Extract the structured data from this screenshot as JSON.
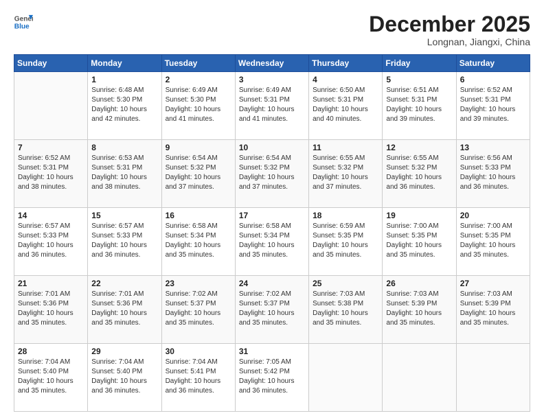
{
  "header": {
    "logo_general": "General",
    "logo_blue": "Blue",
    "month": "December 2025",
    "location": "Longnan, Jiangxi, China"
  },
  "weekdays": [
    "Sunday",
    "Monday",
    "Tuesday",
    "Wednesday",
    "Thursday",
    "Friday",
    "Saturday"
  ],
  "weeks": [
    [
      {
        "day": "",
        "info": ""
      },
      {
        "day": "1",
        "info": "Sunrise: 6:48 AM\nSunset: 5:30 PM\nDaylight: 10 hours\nand 42 minutes."
      },
      {
        "day": "2",
        "info": "Sunrise: 6:49 AM\nSunset: 5:30 PM\nDaylight: 10 hours\nand 41 minutes."
      },
      {
        "day": "3",
        "info": "Sunrise: 6:49 AM\nSunset: 5:31 PM\nDaylight: 10 hours\nand 41 minutes."
      },
      {
        "day": "4",
        "info": "Sunrise: 6:50 AM\nSunset: 5:31 PM\nDaylight: 10 hours\nand 40 minutes."
      },
      {
        "day": "5",
        "info": "Sunrise: 6:51 AM\nSunset: 5:31 PM\nDaylight: 10 hours\nand 39 minutes."
      },
      {
        "day": "6",
        "info": "Sunrise: 6:52 AM\nSunset: 5:31 PM\nDaylight: 10 hours\nand 39 minutes."
      }
    ],
    [
      {
        "day": "7",
        "info": "Sunrise: 6:52 AM\nSunset: 5:31 PM\nDaylight: 10 hours\nand 38 minutes."
      },
      {
        "day": "8",
        "info": "Sunrise: 6:53 AM\nSunset: 5:31 PM\nDaylight: 10 hours\nand 38 minutes."
      },
      {
        "day": "9",
        "info": "Sunrise: 6:54 AM\nSunset: 5:32 PM\nDaylight: 10 hours\nand 37 minutes."
      },
      {
        "day": "10",
        "info": "Sunrise: 6:54 AM\nSunset: 5:32 PM\nDaylight: 10 hours\nand 37 minutes."
      },
      {
        "day": "11",
        "info": "Sunrise: 6:55 AM\nSunset: 5:32 PM\nDaylight: 10 hours\nand 37 minutes."
      },
      {
        "day": "12",
        "info": "Sunrise: 6:55 AM\nSunset: 5:32 PM\nDaylight: 10 hours\nand 36 minutes."
      },
      {
        "day": "13",
        "info": "Sunrise: 6:56 AM\nSunset: 5:33 PM\nDaylight: 10 hours\nand 36 minutes."
      }
    ],
    [
      {
        "day": "14",
        "info": "Sunrise: 6:57 AM\nSunset: 5:33 PM\nDaylight: 10 hours\nand 36 minutes."
      },
      {
        "day": "15",
        "info": "Sunrise: 6:57 AM\nSunset: 5:33 PM\nDaylight: 10 hours\nand 36 minutes."
      },
      {
        "day": "16",
        "info": "Sunrise: 6:58 AM\nSunset: 5:34 PM\nDaylight: 10 hours\nand 35 minutes."
      },
      {
        "day": "17",
        "info": "Sunrise: 6:58 AM\nSunset: 5:34 PM\nDaylight: 10 hours\nand 35 minutes."
      },
      {
        "day": "18",
        "info": "Sunrise: 6:59 AM\nSunset: 5:35 PM\nDaylight: 10 hours\nand 35 minutes."
      },
      {
        "day": "19",
        "info": "Sunrise: 7:00 AM\nSunset: 5:35 PM\nDaylight: 10 hours\nand 35 minutes."
      },
      {
        "day": "20",
        "info": "Sunrise: 7:00 AM\nSunset: 5:35 PM\nDaylight: 10 hours\nand 35 minutes."
      }
    ],
    [
      {
        "day": "21",
        "info": "Sunrise: 7:01 AM\nSunset: 5:36 PM\nDaylight: 10 hours\nand 35 minutes."
      },
      {
        "day": "22",
        "info": "Sunrise: 7:01 AM\nSunset: 5:36 PM\nDaylight: 10 hours\nand 35 minutes."
      },
      {
        "day": "23",
        "info": "Sunrise: 7:02 AM\nSunset: 5:37 PM\nDaylight: 10 hours\nand 35 minutes."
      },
      {
        "day": "24",
        "info": "Sunrise: 7:02 AM\nSunset: 5:37 PM\nDaylight: 10 hours\nand 35 minutes."
      },
      {
        "day": "25",
        "info": "Sunrise: 7:03 AM\nSunset: 5:38 PM\nDaylight: 10 hours\nand 35 minutes."
      },
      {
        "day": "26",
        "info": "Sunrise: 7:03 AM\nSunset: 5:39 PM\nDaylight: 10 hours\nand 35 minutes."
      },
      {
        "day": "27",
        "info": "Sunrise: 7:03 AM\nSunset: 5:39 PM\nDaylight: 10 hours\nand 35 minutes."
      }
    ],
    [
      {
        "day": "28",
        "info": "Sunrise: 7:04 AM\nSunset: 5:40 PM\nDaylight: 10 hours\nand 35 minutes."
      },
      {
        "day": "29",
        "info": "Sunrise: 7:04 AM\nSunset: 5:40 PM\nDaylight: 10 hours\nand 36 minutes."
      },
      {
        "day": "30",
        "info": "Sunrise: 7:04 AM\nSunset: 5:41 PM\nDaylight: 10 hours\nand 36 minutes."
      },
      {
        "day": "31",
        "info": "Sunrise: 7:05 AM\nSunset: 5:42 PM\nDaylight: 10 hours\nand 36 minutes."
      },
      {
        "day": "",
        "info": ""
      },
      {
        "day": "",
        "info": ""
      },
      {
        "day": "",
        "info": ""
      }
    ]
  ]
}
